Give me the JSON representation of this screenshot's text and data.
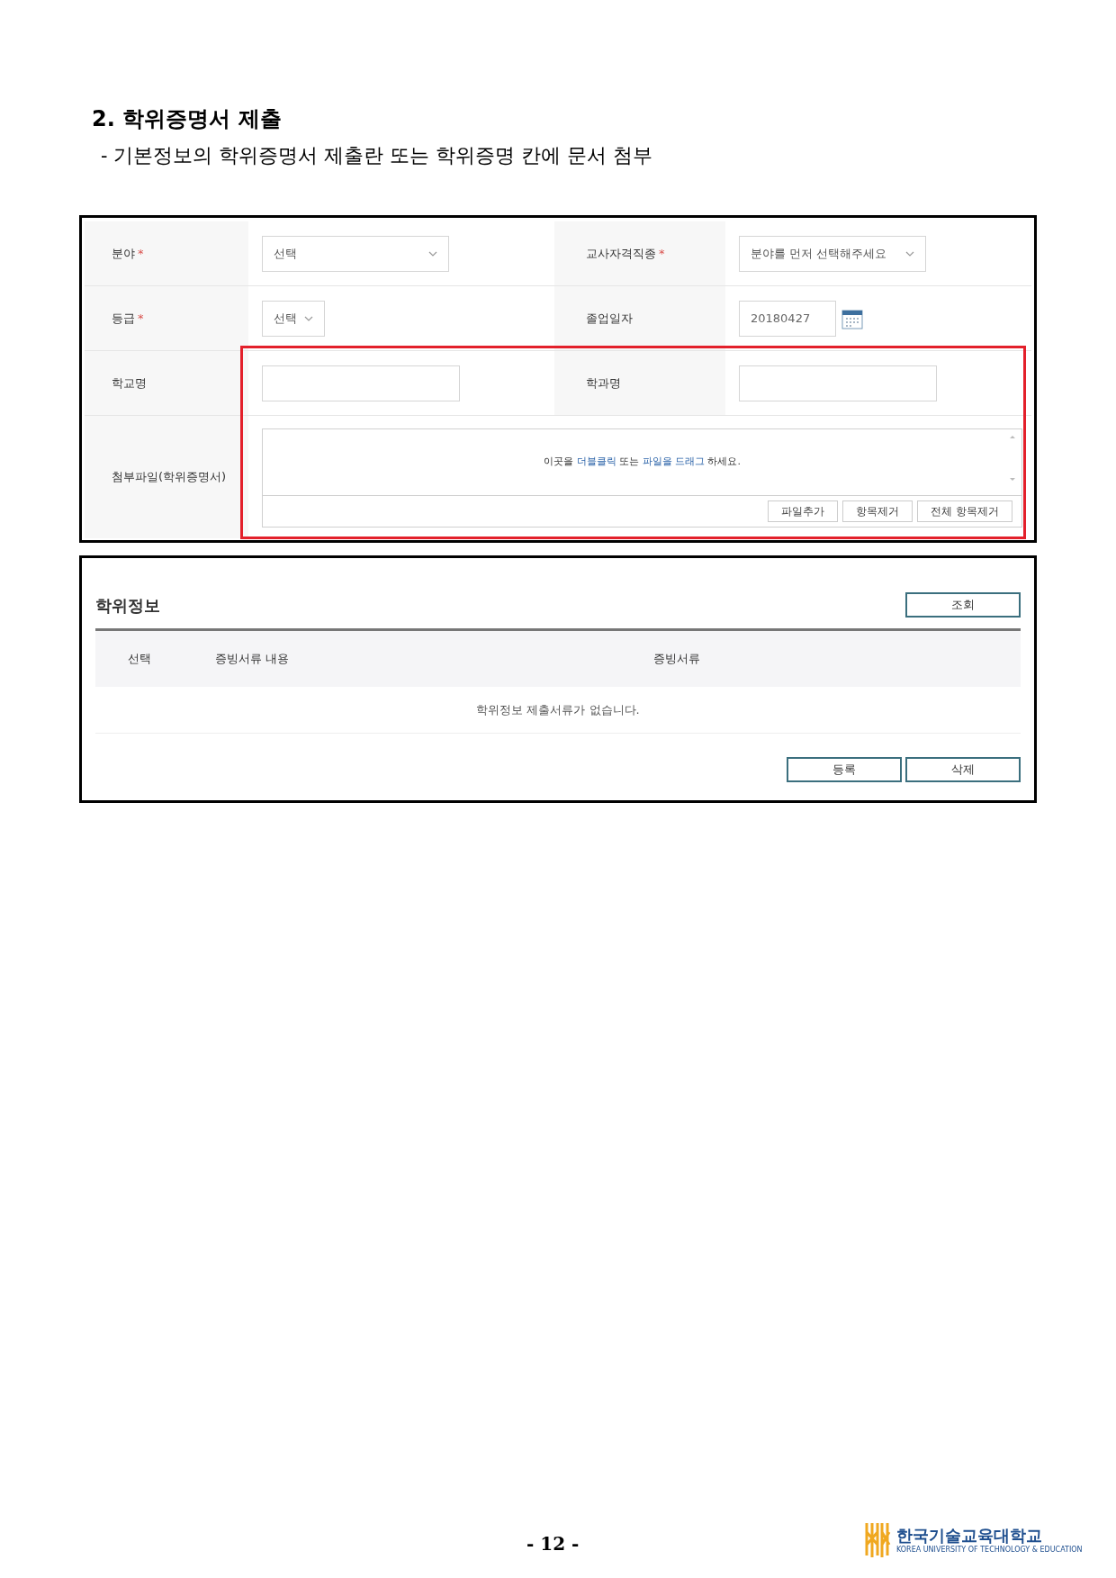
{
  "heading": "2. 학위증명서 제출",
  "subheading": "- 기본정보의 학위증명서 제출란 또는 학위증명 칸에 문서 첨부",
  "form": {
    "rows": [
      {
        "left": {
          "label": "분야",
          "required": true,
          "kind": "select",
          "value": "선택"
        },
        "right": {
          "label": "교사자격직종",
          "required": true,
          "kind": "select",
          "value": "분야를 먼저 선택해주세요"
        }
      },
      {
        "left": {
          "label": "등급",
          "required": true,
          "kind": "select-small",
          "value": "선택"
        },
        "right": {
          "label": "졸업일자",
          "required": false,
          "kind": "date",
          "value": "20180427"
        }
      },
      {
        "left": {
          "label": "학교명",
          "required": false,
          "kind": "text"
        },
        "right": {
          "label": "학과명",
          "required": false,
          "kind": "text"
        }
      }
    ],
    "required_mark": "*",
    "attach": {
      "label": "첨부파일(학위증명서)",
      "hint": [
        "이곳을 ",
        "더블클릭",
        " 또는 ",
        "파일을 드래그",
        " 하세요."
      ],
      "buttons": [
        "파일추가",
        "항목제거",
        "전체 항목제거"
      ]
    }
  },
  "degree": {
    "title": "학위정보",
    "search_button": "조회",
    "columns": [
      "선택",
      "증빙서류 내용",
      "증빙서류"
    ],
    "empty": "학위정보 제출서류가 없습니다.",
    "buttons": [
      "등록",
      "삭제"
    ]
  },
  "footer": {
    "page": "- 12 -",
    "logo_name": "한국기술교육대학교",
    "logo_sub": "KOREA UNIVERSITY OF TECHNOLOGY & EDUCATION"
  }
}
